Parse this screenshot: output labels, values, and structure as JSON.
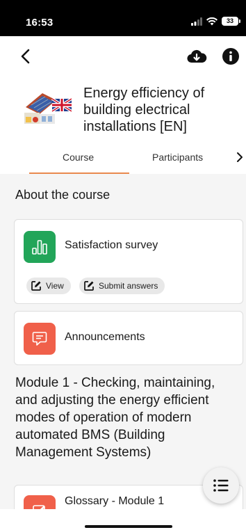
{
  "status_bar": {
    "time": "16:53",
    "battery": "33"
  },
  "app_bar": {
    "back_icon": "chevron-left-icon",
    "download_icon": "cloud-download-icon",
    "info_icon": "info-icon"
  },
  "course": {
    "title": "Energy efficiency of building electrical installations [EN]"
  },
  "tabs": [
    {
      "label": "Course",
      "active": true
    },
    {
      "label": "Participants",
      "active": false
    }
  ],
  "content": {
    "section_title": "About the course",
    "survey": {
      "label": "Satisfaction survey",
      "color": "#22a559",
      "actions": {
        "view": "View",
        "submit": "Submit answers"
      }
    },
    "announcements": {
      "label": "Announcements",
      "color": "#f0604a"
    },
    "module_title": "Module 1 - Checking, maintaining, and adjusting the energy efficient modes of operation of modern automated BMS (Building Management Systems)",
    "glossary": {
      "label": "Glossary - Module 1",
      "color": "#f0604a"
    }
  },
  "accent_color": "#e9894d"
}
